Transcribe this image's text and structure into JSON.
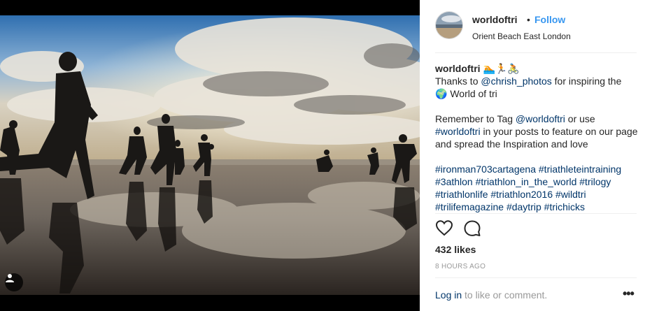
{
  "post": {
    "image_alt": "Triathletes running into the sea on a reflective beach under a cloudy sky",
    "tag_icon": "person-tag-icon"
  },
  "header": {
    "username": "worldoftri",
    "separator": "•",
    "follow_label": "Follow",
    "location": "Orient Beach East London"
  },
  "caption": {
    "username": "worldoftri",
    "emojis": "🏊🏃🚴",
    "line1_prefix": "Thanks to ",
    "mention1": "@chrish_photos",
    "line1_suffix": " for inspiring the",
    "globe": "🌍",
    "line2_text": " World of tri",
    "para2_prefix": "Remember to Tag ",
    "mention2": "@worldoftri",
    "para2_mid": " or use",
    "hashtag_main": "#worldoftri",
    "para2_suffix": " in your posts to feature on our page and spread the Inspiration and love",
    "hashtags": [
      "#ironman703cartagena",
      "#triathleteintraining",
      "#3athlon",
      "#triathlon_in_the_world",
      "#trilogy",
      "#triathlonlife",
      "#triathlon2016",
      "#wildtri",
      "#trilifemagazine",
      "#daytrip",
      "#trichicks"
    ]
  },
  "stats": {
    "likes": "432 likes",
    "time_ago": "8 HOURS AGO"
  },
  "footer": {
    "login_link": "Log in",
    "login_text": " to like or comment.",
    "more_label": "•••"
  },
  "colors": {
    "link_blue": "#003569",
    "follow_blue": "#3897f0",
    "muted": "#999999"
  }
}
